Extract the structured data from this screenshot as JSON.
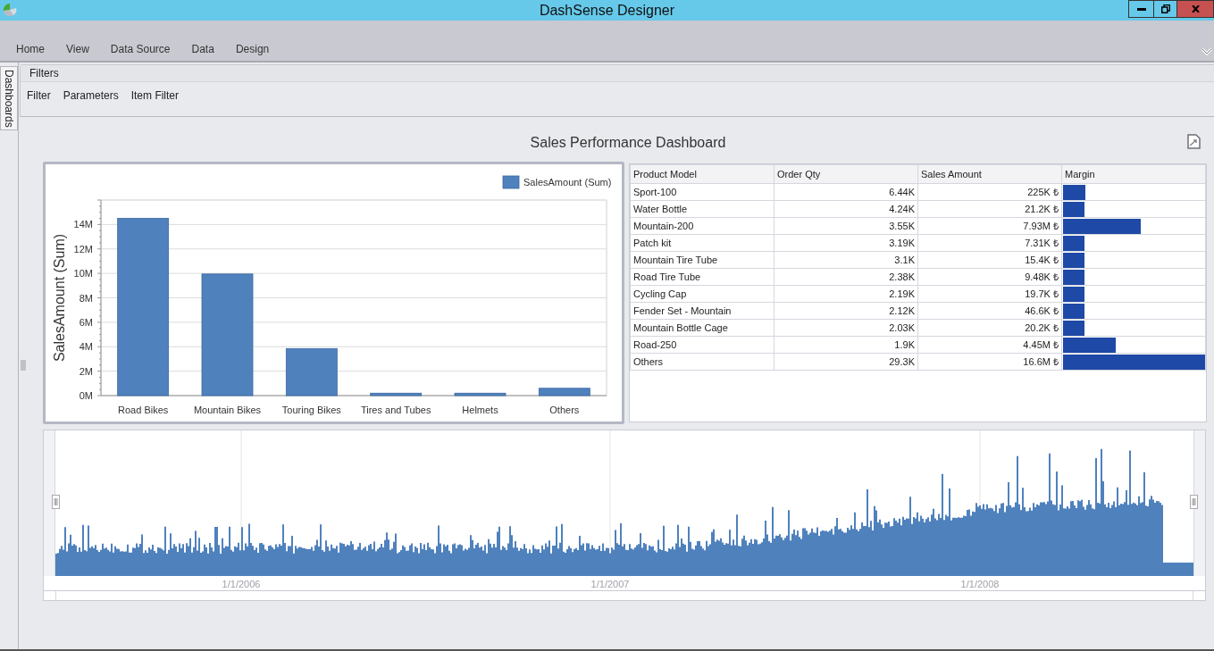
{
  "window": {
    "title": "DashSense Designer"
  },
  "ribbon_tabs": [
    {
      "label": "Home",
      "selected": false
    },
    {
      "label": "View",
      "selected": false
    },
    {
      "label": "Data Source",
      "selected": false
    },
    {
      "label": "Data",
      "selected": false
    },
    {
      "label": "Design",
      "selected": false
    }
  ],
  "side_tab": {
    "label": "Dashboards"
  },
  "filters": {
    "title": "Filters",
    "items": [
      "Filter",
      "Parameters",
      "Item Filter"
    ]
  },
  "dashboard": {
    "title": "Sales Performance Dashboard"
  },
  "bar_chart": {
    "chart_data": {
      "type": "bar",
      "ylabel": "SalesAmount (Sum)",
      "categories": [
        "Road Bikes",
        "Mountain Bikes",
        "Touring Bikes",
        "Tires and Tubes",
        "Helmets",
        "Others"
      ],
      "series": [
        {
          "name": "SalesAmount (Sum)",
          "color": "#4f81bd",
          "values": [
            14500000,
            9950000,
            3850000,
            200000,
            200000,
            600000
          ]
        }
      ],
      "ylim": [
        0,
        16000000
      ],
      "grid": true,
      "yticks": [
        {
          "value": 0,
          "label": "0M"
        },
        {
          "value": 2000000,
          "label": "2M"
        },
        {
          "value": 4000000,
          "label": "4M"
        },
        {
          "value": 6000000,
          "label": "6M"
        },
        {
          "value": 8000000,
          "label": "8M"
        },
        {
          "value": 10000000,
          "label": "10M"
        },
        {
          "value": 12000000,
          "label": "12M"
        },
        {
          "value": 14000000,
          "label": "14M"
        }
      ]
    }
  },
  "table": {
    "columns": [
      "Product Model",
      "Order Qty",
      "Sales Amount",
      "Margin"
    ],
    "rows": [
      {
        "product": "Sport-100",
        "qty": "6.44K",
        "amount": "225K ₺",
        "level": 0.16
      },
      {
        "product": "Water Bottle",
        "qty": "4.24K",
        "amount": "21.2K ₺",
        "level": 0.15
      },
      {
        "product": "Mountain-200",
        "qty": "3.55K",
        "amount": "7.93M ₺",
        "level": 0.55
      },
      {
        "product": "Patch kit",
        "qty": "3.19K",
        "amount": "7.31K ₺",
        "level": 0.15
      },
      {
        "product": "Mountain Tire Tube",
        "qty": "3.1K",
        "amount": "15.4K ₺",
        "level": 0.15
      },
      {
        "product": "Road Tire Tube",
        "qty": "2.38K",
        "amount": "9.48K ₺",
        "level": 0.15
      },
      {
        "product": "Cycling Cap",
        "qty": "2.19K",
        "amount": "19.7K ₺",
        "level": 0.15
      },
      {
        "product": "Fender Set - Mountain",
        "qty": "2.12K",
        "amount": "46.6K ₺",
        "level": 0.15
      },
      {
        "product": "Mountain Bottle Cage",
        "qty": "2.03K",
        "amount": "20.2K ₺",
        "level": 0.15
      },
      {
        "product": "Road-250",
        "qty": "1.9K",
        "amount": "4.45M ₺",
        "level": 0.37
      },
      {
        "product": "Others",
        "qty": "29.3K",
        "amount": "16.6M ₺",
        "level": 1
      }
    ]
  },
  "range_chart": {
    "axis_labels": [
      "1/1/2006",
      "1/1/2007",
      "1/1/2008"
    ]
  }
}
